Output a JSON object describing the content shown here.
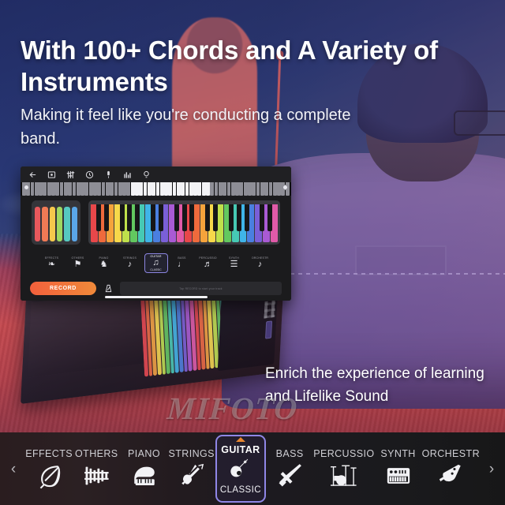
{
  "headline": "With 100+ Chords and A Variety of Instruments",
  "subheadline": "Making it feel like you're conducting a complete band.",
  "caption": "Enrich the experience of learning and Lifelike Sound",
  "watermark": "MIFOTO",
  "colors": {
    "accent_purple": "#8f86e6",
    "accent_orange": "#e8862f",
    "record_start": "#f2603c",
    "record_end": "#f08a3a",
    "toolbar_bg": "#1a1a1d",
    "app_bg": "#1b1b1d",
    "text_primary": "#ffffff",
    "text_muted": "#cfcfd4"
  },
  "app": {
    "toolbar_icons": [
      "back-arrow-icon",
      "screenshot-icon",
      "sliders-icon",
      "metronome-circle-icon",
      "microphone-icon",
      "equalizer-icon",
      "lightbulb-icon"
    ],
    "picker_items": [
      {
        "label": "EFFECTS",
        "glyph": "❧"
      },
      {
        "label": "OTHERS",
        "glyph": "⚑"
      },
      {
        "label": "PIANO",
        "glyph": "♞"
      },
      {
        "label": "STRINGS",
        "glyph": "♪"
      },
      {
        "label": "GUITAR",
        "glyph": "♫",
        "sub": "CLASSIC",
        "selected": true
      },
      {
        "label": "BASS",
        "glyph": "♩"
      },
      {
        "label": "PERCUSSIO",
        "glyph": "♬"
      },
      {
        "label": "SYNTH",
        "glyph": "☰"
      },
      {
        "label": "ORCHESTR",
        "glyph": "♪"
      }
    ],
    "record_label": "RECORD",
    "metronome_icon": "metronome-icon",
    "track_placeholder": "Tap RECORD to start your track"
  },
  "bottom_toolbar": {
    "prev_label": "‹",
    "next_label": "›",
    "instruments": [
      {
        "name": "EFFECTS",
        "icon": "leaf-icon"
      },
      {
        "name": "OTHERS",
        "icon": "marimba-icon"
      },
      {
        "name": "PIANO",
        "icon": "grand-piano-icon"
      },
      {
        "name": "STRINGS",
        "icon": "violin-icon"
      },
      {
        "name": "GUITAR",
        "icon": "acoustic-guitar-icon",
        "sub": "CLASSIC",
        "selected": true
      },
      {
        "name": "BASS",
        "icon": "bass-guitar-icon"
      },
      {
        "name": "PERCUSSIO",
        "icon": "drum-kit-icon"
      },
      {
        "name": "SYNTH",
        "icon": "synthesizer-icon"
      },
      {
        "name": "ORCHESTR",
        "icon": "saxophone-icon"
      }
    ]
  },
  "key_colors": [
    "#e8474a",
    "#ef6a3c",
    "#f5a33b",
    "#f7d84a",
    "#bfe04b",
    "#62c85f",
    "#46c9b4",
    "#3fb4e8",
    "#4a7fe0",
    "#7a5fd8",
    "#a95ad4",
    "#e05aa8"
  ],
  "pad_colors": [
    "#e8585c",
    "#f07a55",
    "#f5c84c",
    "#9fd861",
    "#56c9c1",
    "#5aa6e8"
  ]
}
